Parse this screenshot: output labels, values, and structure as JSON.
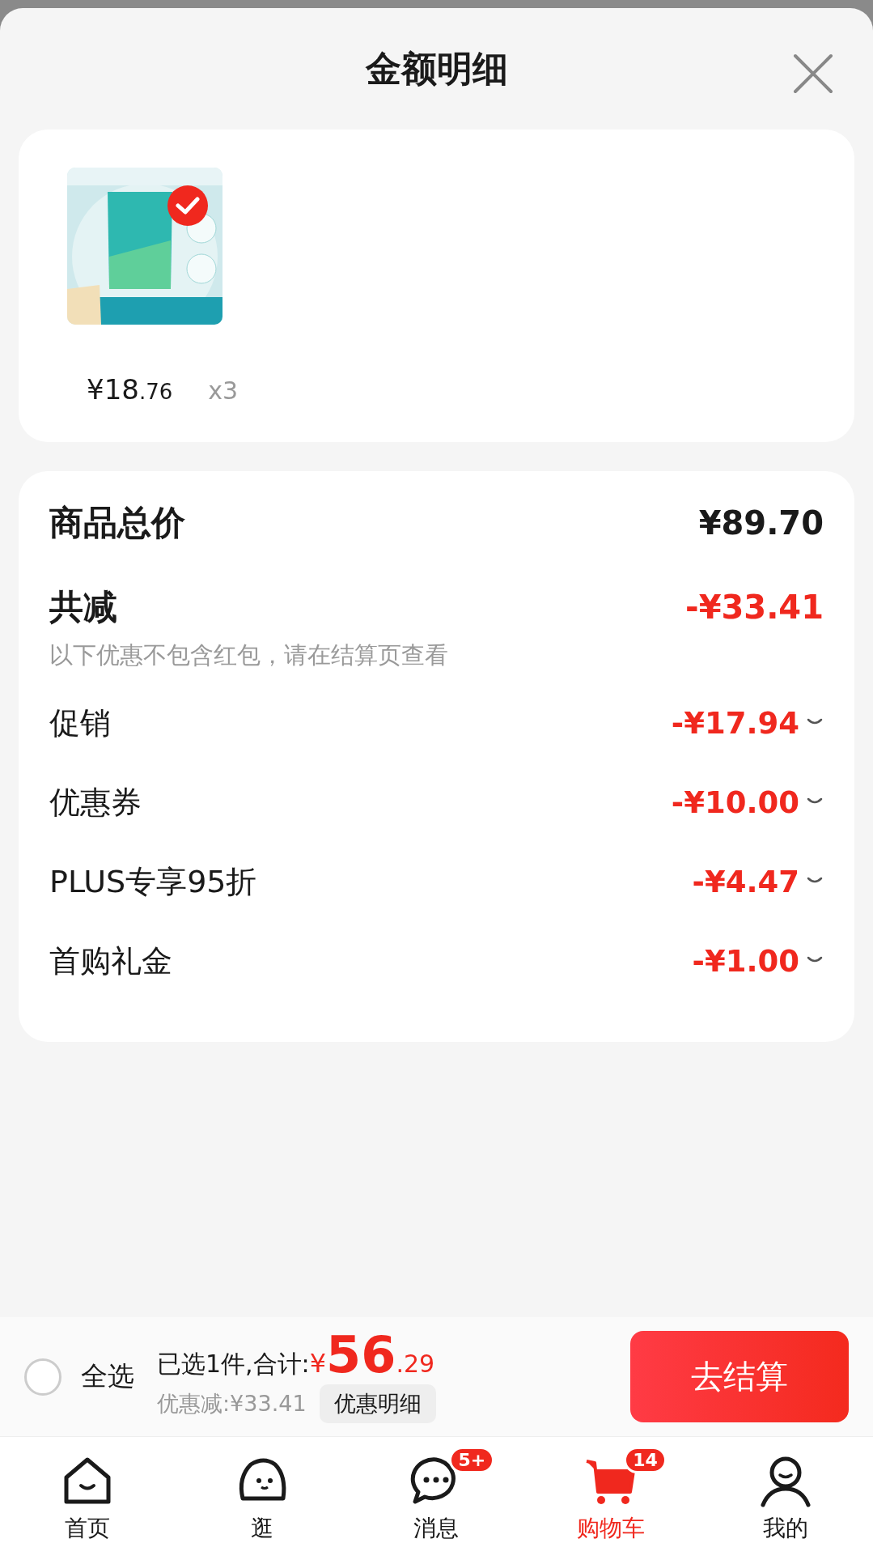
{
  "title": "金额明细",
  "product": {
    "selected": true,
    "price_main": "¥18",
    "price_decimal": ".76",
    "quantity": "x3"
  },
  "summary": {
    "total": {
      "label": "商品总价",
      "value": "¥89.70"
    },
    "discount": {
      "label": "共减",
      "value": "-¥33.41",
      "note": "以下优惠不包含红包，请在结算页查看"
    },
    "items": [
      {
        "label": "促销",
        "value": "-¥17.94",
        "expanded": false
      },
      {
        "label": "优惠券",
        "value": "-¥10.00",
        "expanded": false
      },
      {
        "label": "PLUS专享95折",
        "value": "-¥4.47",
        "expanded": false
      },
      {
        "label": "首购礼金",
        "value": "-¥1.00",
        "expanded": false
      }
    ]
  },
  "checkout": {
    "select_all": {
      "label": "全选",
      "checked": false
    },
    "count_text": "已选1件,合计:",
    "currency": "¥",
    "amount_main": "56",
    "amount_decimal": ".29",
    "saving": "优惠减:¥33.41",
    "details_button": "优惠明细",
    "submit": "去结算"
  },
  "nav": [
    {
      "kind": "home",
      "label": "首页",
      "selected": false
    },
    {
      "kind": "browse",
      "label": "逛",
      "selected": false
    },
    {
      "kind": "messages",
      "label": "消息",
      "selected": false,
      "badge": "5+"
    },
    {
      "kind": "cart",
      "label": "购物车",
      "selected": true,
      "badge": "14"
    },
    {
      "kind": "profile",
      "label": "我的",
      "selected": false
    }
  ]
}
